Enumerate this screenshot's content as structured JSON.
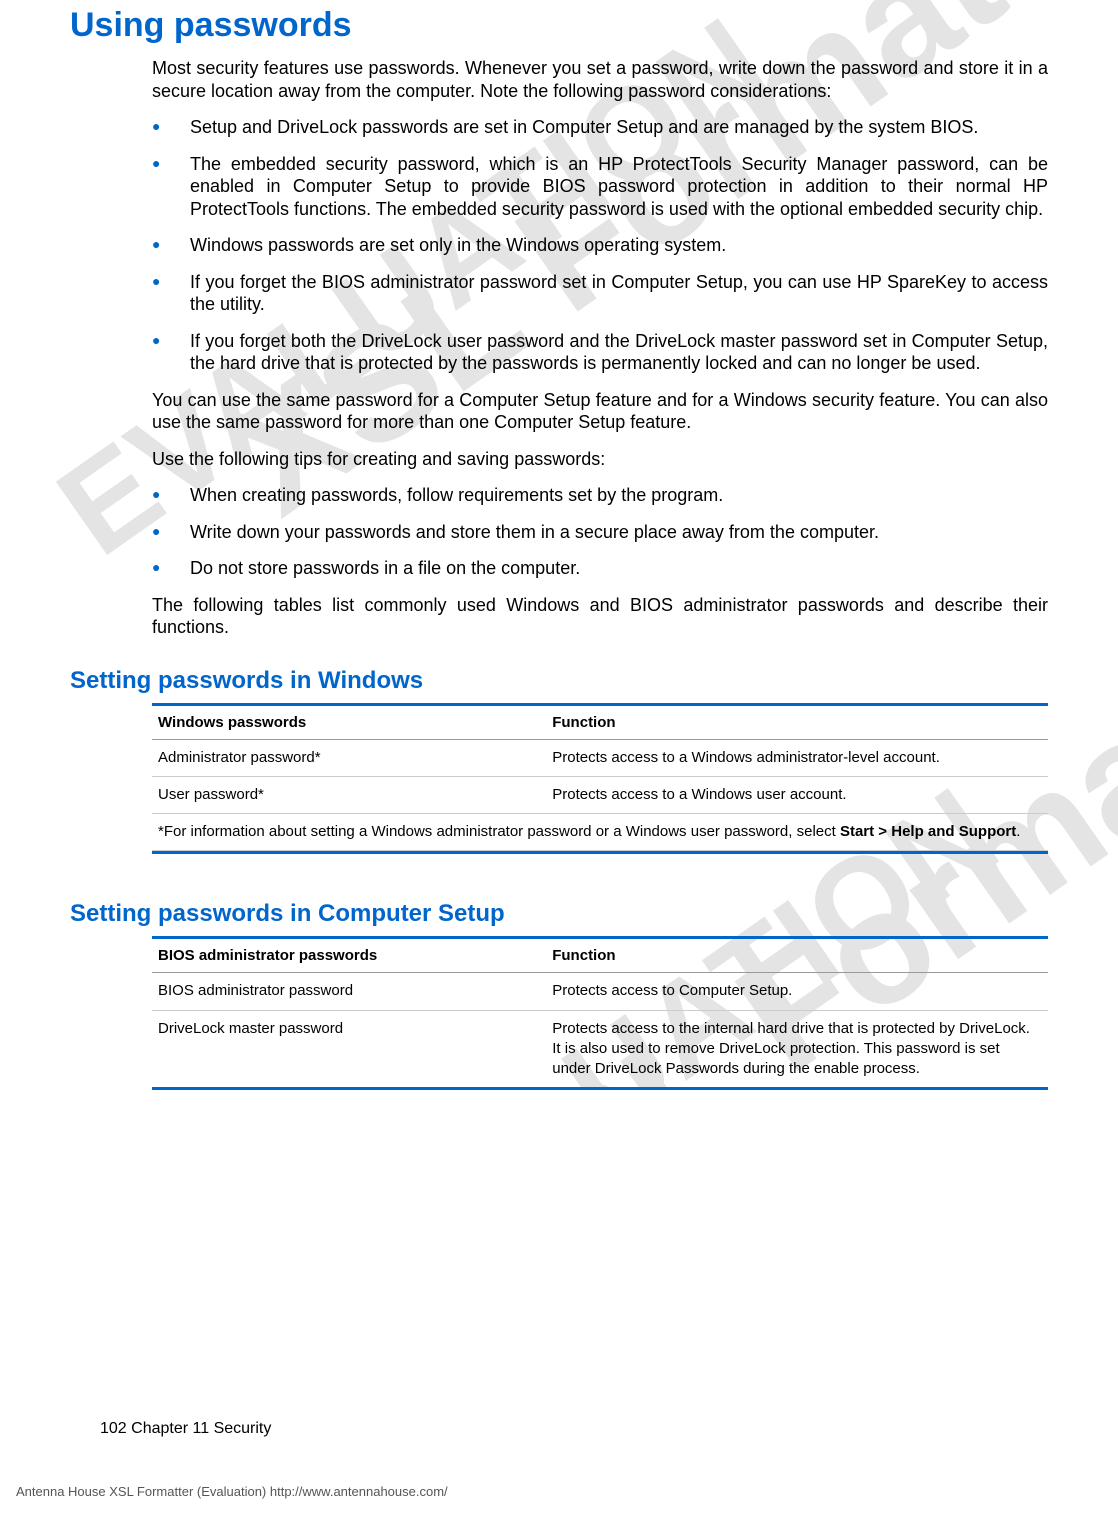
{
  "heading": "Using passwords",
  "intro": "Most security features use passwords. Whenever you set a password, write down the password and store it in a secure location away from the computer. Note the following password considerations:",
  "bullets1": [
    "Setup and DriveLock passwords are set in Computer Setup and are managed by the system BIOS.",
    "The embedded security password, which is an HP ProtectTools Security Manager password, can be enabled in Computer Setup to provide BIOS password protection in addition to their normal HP ProtectTools functions. The embedded security password is used with the optional embedded security chip.",
    "Windows passwords are set only in the Windows operating system.",
    "If you forget the BIOS administrator password set in Computer Setup, you can use HP SpareKey to access the utility.",
    "If you forget both the DriveLock user password and the DriveLock master password set in Computer Setup, the hard drive that is protected by the passwords is permanently locked and can no longer be used."
  ],
  "para2": "You can use the same password for a Computer Setup feature and for a Windows security feature. You can also use the same password for more than one Computer Setup feature.",
  "para3": "Use the following tips for creating and saving passwords:",
  "bullets2": [
    "When creating passwords, follow requirements set by the program.",
    "Write down your passwords and store them in a secure place away from the computer.",
    "Do not store passwords in a file on the computer."
  ],
  "para4": "The following tables list commonly used Windows and BIOS administrator passwords and describe their functions.",
  "section2": {
    "heading": "Setting passwords in Windows",
    "table": {
      "headers": [
        "Windows passwords",
        "Function"
      ],
      "rows": [
        [
          "Administrator password*",
          "Protects access to a Windows administrator-level account."
        ],
        [
          "User password*",
          "Protects access to a Windows user account."
        ]
      ],
      "note_prefix": "*For information about setting a Windows administrator password or a Windows user password, select ",
      "note_bold": "Start > Help and Support",
      "note_suffix": "."
    }
  },
  "section3": {
    "heading": "Setting passwords in Computer Setup",
    "table": {
      "headers": [
        "BIOS administrator passwords",
        "Function"
      ],
      "rows": [
        [
          "BIOS administrator password",
          "Protects access to Computer Setup."
        ],
        [
          "DriveLock master password",
          "Protects access to the internal hard drive that is protected by DriveLock. It is also used to remove DriveLock protection. This password is set under DriveLock Passwords during the enable process."
        ]
      ]
    }
  },
  "footer": {
    "page_line": "102   Chapter 11   Security",
    "credit": "Antenna House XSL Formatter (Evaluation)  http://www.antennahouse.com/"
  },
  "watermark": {
    "line1": "XSL Formatter",
    "line2": "EVALUATION",
    "line3": "XSL Formatter",
    "line4": "EVALUATION"
  }
}
